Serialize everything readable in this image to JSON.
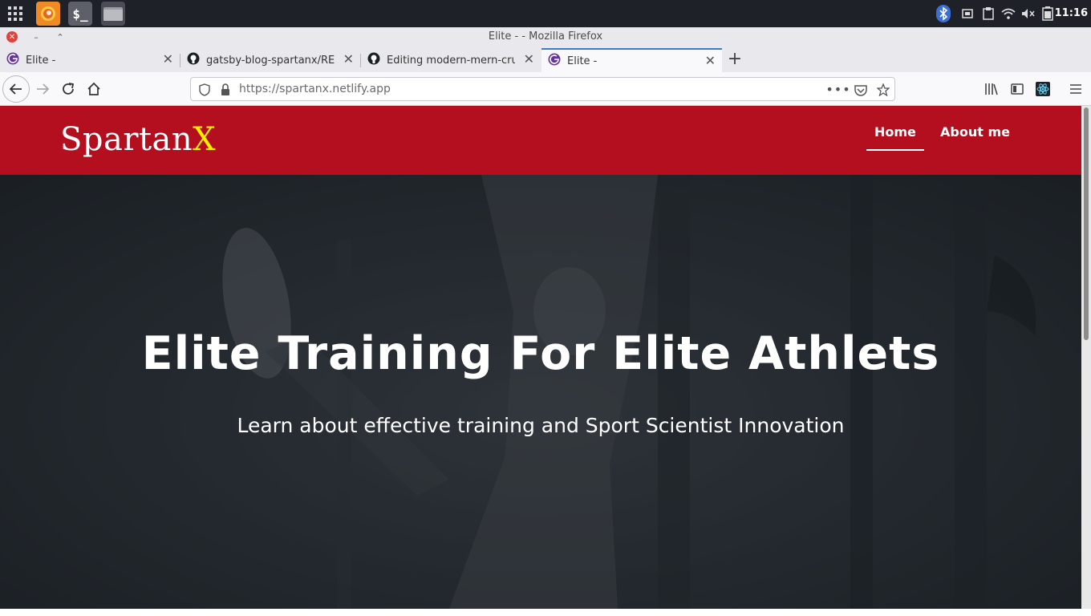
{
  "os": {
    "clock": "11:16",
    "launchers": {
      "apps_icon": "apps-grid-icon",
      "firefox_icon": "firefox-icon",
      "terminal_label": "$_",
      "files_icon": "folder-icon"
    },
    "tray_icons": [
      "bluetooth-icon",
      "memory-icon",
      "clipboard-icon",
      "wifi-icon",
      "volume-muted-icon",
      "battery-icon"
    ]
  },
  "browser": {
    "window_title": "Elite - - Mozilla Firefox",
    "tabs": [
      {
        "label": "Elite -",
        "icon": "gatsby-icon",
        "active": false
      },
      {
        "label": "gatsby-blog-spartanx/READ",
        "icon": "github-icon",
        "active": false
      },
      {
        "label": "Editing modern-mern-crud",
        "icon": "github-icon",
        "active": false
      },
      {
        "label": "Elite -",
        "icon": "gatsby-icon",
        "active": true
      }
    ],
    "url": "https://spartanx.netlify.app",
    "colors": {
      "tab_accent": "#3d7ad4",
      "chrome_bg": "#e9e9ed"
    }
  },
  "site": {
    "brand": {
      "main": "Spartan",
      "accent": "X"
    },
    "nav": {
      "home": "Home",
      "about": "About me"
    },
    "hero": {
      "title": "Elite Training For Elite Athlets",
      "subtitle": "Learn about effective training and Sport Scientist Innovation"
    },
    "colors": {
      "header": "#b30f1f",
      "brand_accent": "#ffee00",
      "hero_bg": "#2b3036"
    }
  }
}
